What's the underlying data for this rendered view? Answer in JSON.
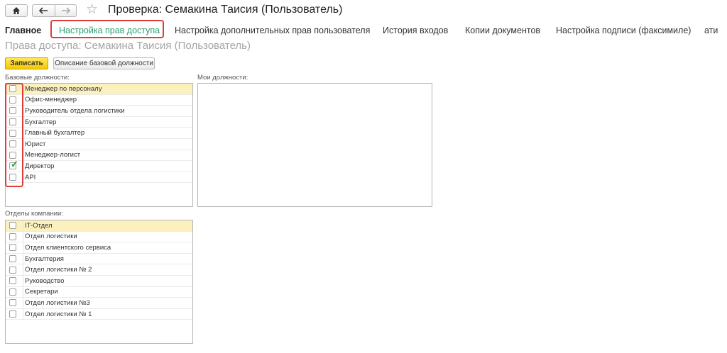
{
  "window": {
    "title": "Проверка: Семакина Таисия (Пользователь)"
  },
  "tabs": [
    {
      "label": "Главное"
    },
    {
      "label": "Настройка прав доступа"
    },
    {
      "label": "Настройка дополнительных прав пользователя"
    },
    {
      "label": "История входов"
    },
    {
      "label": "Копии документов"
    },
    {
      "label": "Настройка подписи (факсимиле)"
    },
    {
      "label": "ати"
    }
  ],
  "page": {
    "subtitle": "Права доступа: Семакина Таисия (Пользователь)"
  },
  "toolbar": {
    "save_label": "Записать",
    "description_label": "Описание базовой должности"
  },
  "base_positions": {
    "label": "Базовые должности:",
    "items": [
      {
        "label": "Менеджер по персоналу",
        "checked": false
      },
      {
        "label": "Офис-менеджер",
        "checked": false
      },
      {
        "label": "Руководитель отдела логистики",
        "checked": false
      },
      {
        "label": "Бухгалтер",
        "checked": false
      },
      {
        "label": "Главный бухгалтер",
        "checked": false
      },
      {
        "label": "Юрист",
        "checked": false
      },
      {
        "label": "Менеджер-логист",
        "checked": false
      },
      {
        "label": "Директор",
        "checked": true
      },
      {
        "label": "API",
        "checked": false
      }
    ]
  },
  "my_positions": {
    "label": "Мои должности:"
  },
  "departments": {
    "label": "Отделы компании:",
    "items": [
      {
        "label": "IT-Отдел",
        "checked": false
      },
      {
        "label": "Отдел логистики",
        "checked": false
      },
      {
        "label": "Отдел клиентского сервиса",
        "checked": false
      },
      {
        "label": "Бухгалтерия",
        "checked": false
      },
      {
        "label": "Отдел логистики № 2",
        "checked": false
      },
      {
        "label": "Руководство",
        "checked": false
      },
      {
        "label": "Секретари",
        "checked": false
      },
      {
        "label": "Отдел логистики №3",
        "checked": false
      },
      {
        "label": "Отдел логистики № 1",
        "checked": false
      }
    ]
  },
  "colors": {
    "accent_tab": "#2f9e77",
    "highlight": "#e03a3a",
    "primary_button": "#f3c800",
    "selected_row": "#fbf1bf"
  }
}
